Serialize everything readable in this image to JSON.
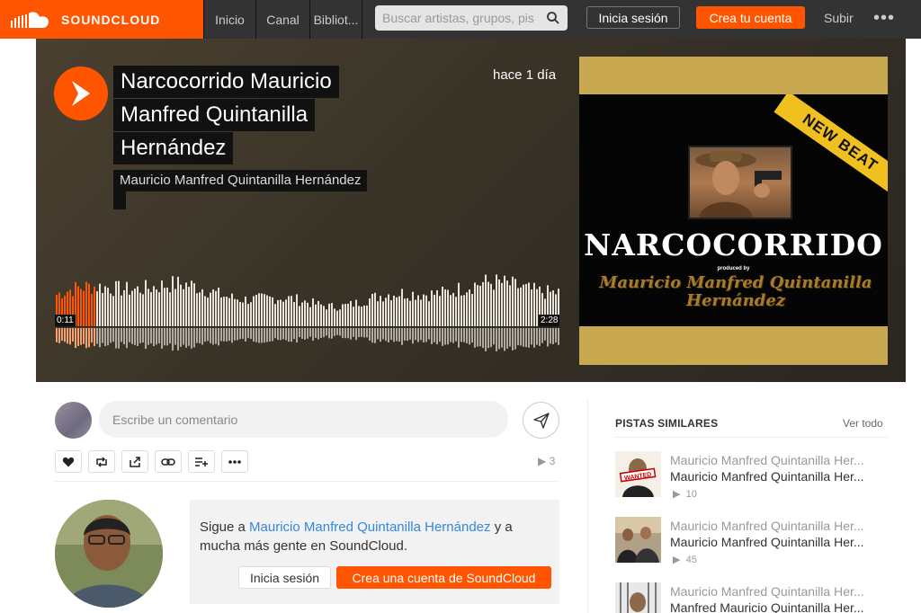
{
  "header": {
    "brand": "SOUNDCLOUD",
    "nav": [
      "Inicio",
      "Canal",
      "Bibliot..."
    ],
    "search_placeholder": "Buscar artistas, grupos, pis",
    "login": "Inicia sesión",
    "create": "Crea tu cuenta",
    "upload": "Subir",
    "more": "•••"
  },
  "hero": {
    "title_lines": [
      "Narcocorrido Mauricio",
      "Manfred Quintanilla",
      "Hernández"
    ],
    "artist": "Mauricio Manfred Quintanilla Hernández",
    "time_ago": "hace 1 día",
    "current_time": "0:11",
    "duration": "2:28",
    "progress": 0.075,
    "artwork": {
      "banner": "NEW BEAT",
      "title": "NARCOCORRIDO",
      "produced": "produced by",
      "name_lines": [
        "Mauricio Manfred Quintanilla",
        "Hernández"
      ]
    }
  },
  "comment": {
    "placeholder": "Escribe un comentario"
  },
  "actions": {
    "play_count": "3",
    "icons": [
      "heart-icon",
      "repost-icon",
      "share-icon",
      "link-icon",
      "add-to-playlist-icon",
      "more-icon"
    ]
  },
  "follow": {
    "prefix": "Sigue a ",
    "artist": "Mauricio Manfred Quintanilla Hernández",
    "suffix": " y a mucha más gente en SoundCloud.",
    "login": "Inicia sesión",
    "create": "Crea una cuenta de SoundCloud"
  },
  "sidebar": {
    "title": "PISTAS SIMILARES",
    "view_all": "Ver todo",
    "tracks": [
      {
        "artist": "Mauricio Manfred Quintanilla Her...",
        "title": "Mauricio Manfred Quintanilla Her...",
        "plays": "10"
      },
      {
        "artist": "Mauricio Manfred Quintanilla Her...",
        "title": "Mauricio Manfred Quintanilla Her...",
        "plays": "45"
      },
      {
        "artist": "Mauricio Manfred Quintanilla Her...",
        "title": "Manfred Mauricio Quintanilla Her...",
        "plays": ""
      }
    ]
  },
  "colors": {
    "accent": "#ff5500",
    "header_bg": "#333333",
    "link": "#3388dd"
  }
}
